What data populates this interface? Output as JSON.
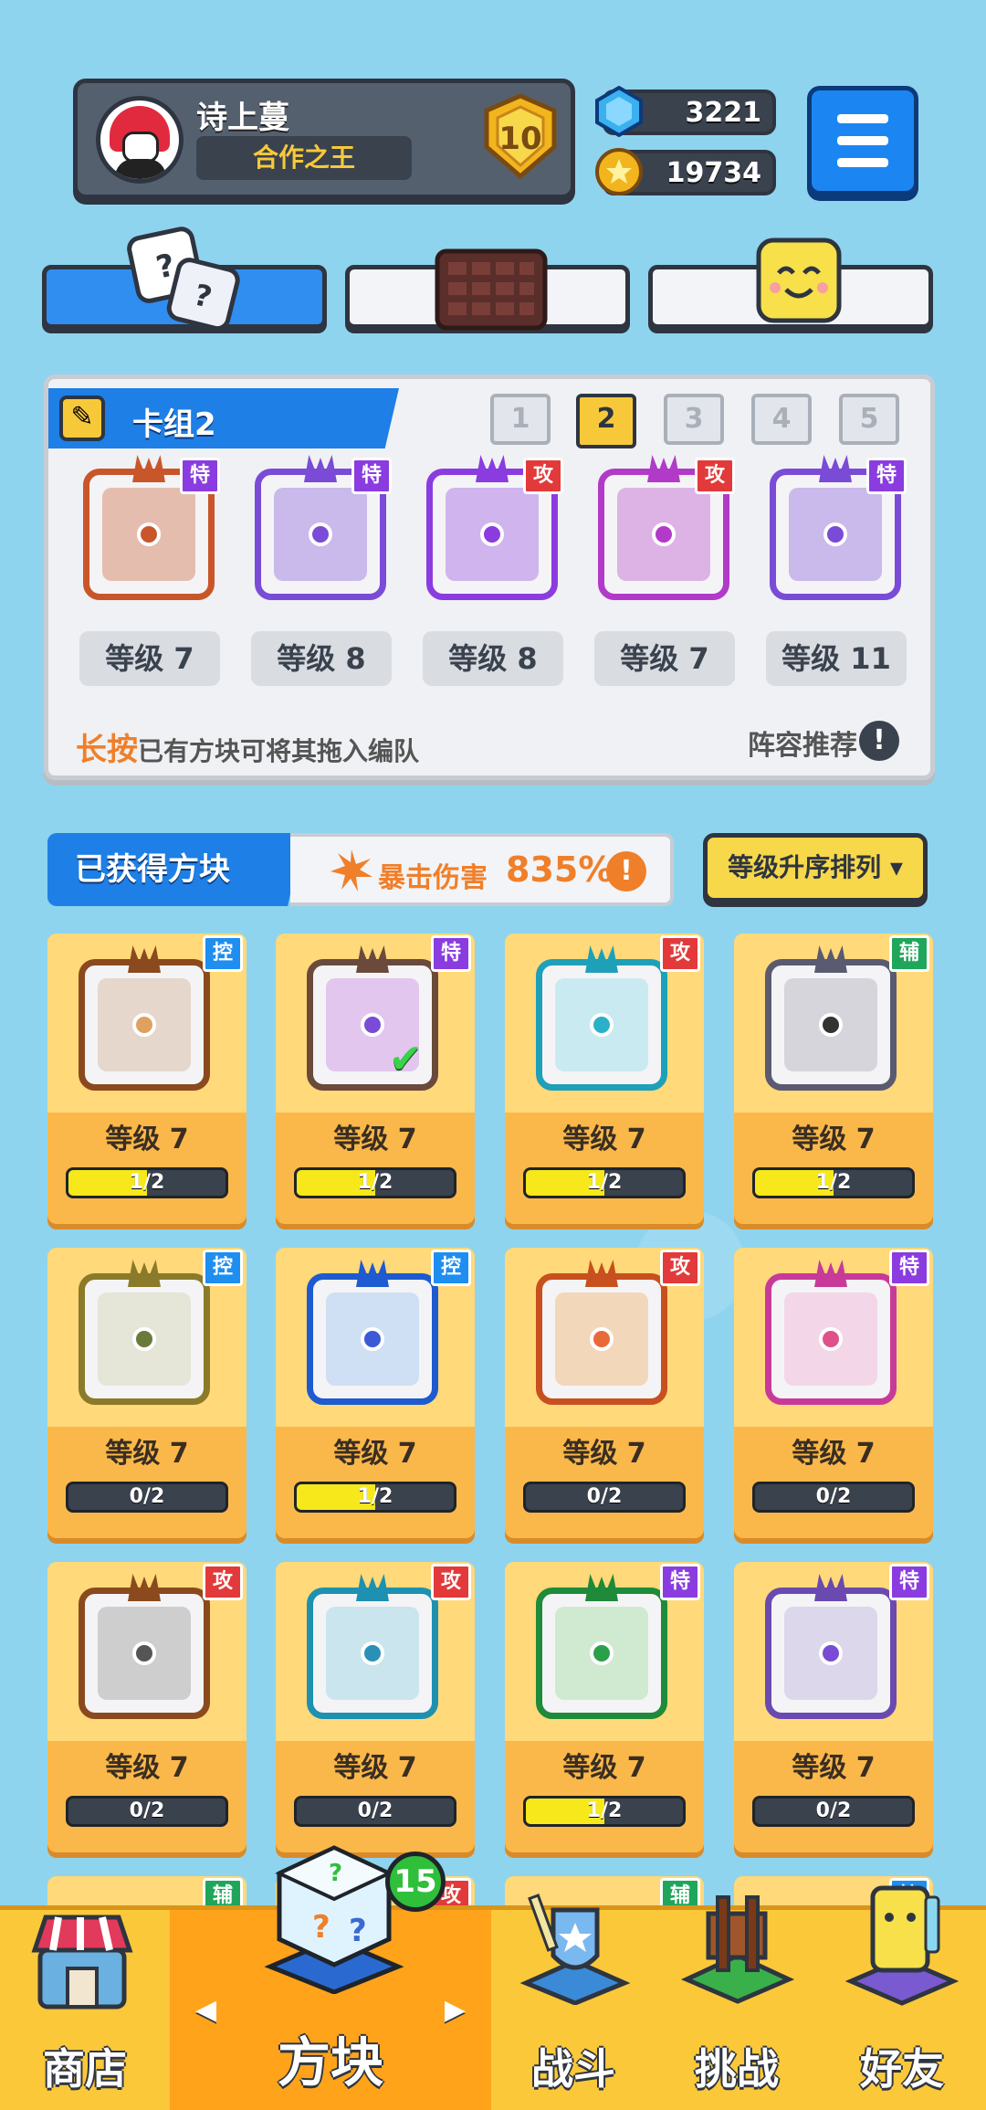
{
  "header": {
    "player_name": "诗上蔓",
    "player_title": "合作之王",
    "rank": "10",
    "gems": "3221",
    "coins": "19734"
  },
  "tabs": [
    {
      "id": "dice",
      "active": true
    },
    {
      "id": "board",
      "active": false
    },
    {
      "id": "emote",
      "active": false
    }
  ],
  "deck": {
    "label": "卡组2",
    "numbers": [
      "1",
      "2",
      "3",
      "4",
      "5"
    ],
    "active_number": "2",
    "cards": [
      {
        "tag": "特",
        "tag_type": "spc",
        "level": "等级 7",
        "color": "#c9562a"
      },
      {
        "tag": "特",
        "tag_type": "spc",
        "level": "等级 8",
        "color": "#7a4bd6"
      },
      {
        "tag": "攻",
        "tag_type": "atk",
        "level": "等级 8",
        "color": "#8a3ce0"
      },
      {
        "tag": "攻",
        "tag_type": "atk",
        "level": "等级 7",
        "color": "#b23ac8"
      },
      {
        "tag": "特",
        "tag_type": "spc",
        "level": "等级 11",
        "color": "#7a4bd6"
      }
    ],
    "hint_highlight": "长按",
    "hint_text": "已有方块可将其拖入编队",
    "recommend": "阵容推荐"
  },
  "owned": {
    "label": "已获得方块",
    "crit_label": "暴击伤害",
    "crit_value": "835%",
    "sort_label": "等级升序排列 ▾",
    "cards": [
      {
        "tag": "控",
        "tag_type": "ctl",
        "level": "等级 7",
        "progress": "1/2",
        "fill": 0.5,
        "frame": "#8a4a1e",
        "dot": "#e0a060",
        "pat": "#c9a07a",
        "selected": false
      },
      {
        "tag": "特",
        "tag_type": "spc",
        "level": "等级 7",
        "progress": "1/2",
        "fill": 0.5,
        "frame": "#6a4a3a",
        "dot": "#7a4bd6",
        "pat": "#c070e0",
        "selected": true
      },
      {
        "tag": "攻",
        "tag_type": "atk",
        "level": "等级 7",
        "progress": "1/2",
        "fill": 0.5,
        "frame": "#1ea0b8",
        "dot": "#2ab0c8",
        "pat": "#7ad8e8",
        "selected": false
      },
      {
        "tag": "辅",
        "tag_type": "sup",
        "level": "等级 7",
        "progress": "1/2",
        "fill": 0.5,
        "frame": "#5a5a70",
        "dot": "#333333",
        "pat": "#9a9aa8",
        "selected": false
      },
      {
        "tag": "控",
        "tag_type": "ctl",
        "level": "等级 7",
        "progress": "0/2",
        "fill": 0,
        "frame": "#8a7a2a",
        "dot": "#6a7a3a",
        "pat": "#c8c8a0",
        "selected": false
      },
      {
        "tag": "控",
        "tag_type": "ctl",
        "level": "等级 7",
        "progress": "1/2",
        "fill": 0.5,
        "frame": "#1e5ad0",
        "dot": "#3a5ad8",
        "pat": "#8ab8f0",
        "selected": false
      },
      {
        "tag": "攻",
        "tag_type": "atk",
        "level": "等级 7",
        "progress": "0/2",
        "fill": 0,
        "frame": "#c8501e",
        "dot": "#e86a3a",
        "pat": "#f0a04a",
        "selected": false
      },
      {
        "tag": "特",
        "tag_type": "spc",
        "level": "等级 7",
        "progress": "0/2",
        "fill": 0,
        "frame": "#c83a9a",
        "dot": "#e0508a",
        "pat": "#f0a0d0",
        "selected": false
      },
      {
        "tag": "攻",
        "tag_type": "atk",
        "level": "等级 7",
        "progress": "0/2",
        "fill": 0,
        "frame": "#8a4a1e",
        "dot": "#555555",
        "pat": "#888888",
        "selected": false
      },
      {
        "tag": "攻",
        "tag_type": "atk",
        "level": "等级 7",
        "progress": "0/2",
        "fill": 0,
        "frame": "#1e90b0",
        "dot": "#2a90b8",
        "pat": "#7ac8e0",
        "selected": false
      },
      {
        "tag": "特",
        "tag_type": "spc",
        "level": "等级 7",
        "progress": "1/2",
        "fill": 0.5,
        "frame": "#1e8a3a",
        "dot": "#2aa04a",
        "pat": "#8ad88a",
        "selected": false
      },
      {
        "tag": "特",
        "tag_type": "spc",
        "level": "等级 7",
        "progress": "0/2",
        "fill": 0,
        "frame": "#6a4ab0",
        "dot": "#7a4bd6",
        "pat": "#b0a0d8",
        "selected": false
      }
    ],
    "partial_tags": [
      {
        "tag": "辅",
        "tag_type": "sup"
      },
      {
        "tag": "攻",
        "tag_type": "atk"
      },
      {
        "tag": "辅",
        "tag_type": "sup"
      },
      {
        "tag": "控",
        "tag_type": "ctl"
      }
    ]
  },
  "nav": {
    "items": [
      {
        "label": "商店",
        "icon": "shop-icon",
        "active": false
      },
      {
        "label": "方块",
        "icon": "dice-box-icon",
        "active": true,
        "badge": "15"
      },
      {
        "label": "战斗",
        "icon": "battle-icon",
        "active": false
      },
      {
        "label": "挑战",
        "icon": "challenge-icon",
        "active": false
      },
      {
        "label": "好友",
        "icon": "friends-icon",
        "active": false
      }
    ]
  }
}
